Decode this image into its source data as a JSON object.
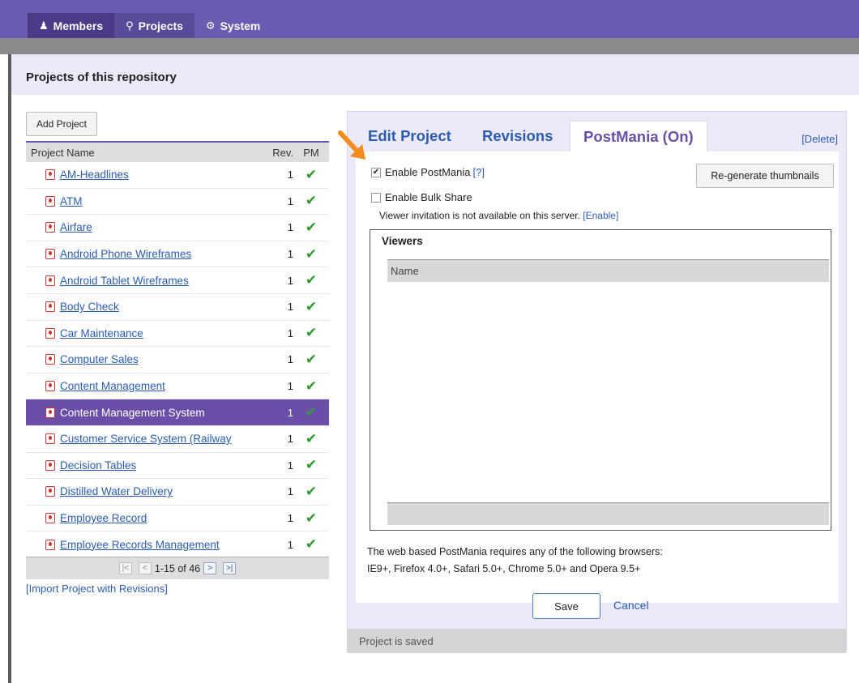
{
  "nav": {
    "tabs": [
      {
        "label": "Members",
        "icon": "person-icon"
      },
      {
        "label": "Projects",
        "icon": "pin-icon"
      },
      {
        "label": "System",
        "icon": "gear-icon"
      }
    ]
  },
  "page": {
    "title": "Projects of this repository"
  },
  "left": {
    "add_button": "Add Project",
    "columns": {
      "name": "Project Name",
      "rev": "Rev.",
      "pm": "PM"
    },
    "rows": [
      {
        "name": "AM-Headlines",
        "rev": "1",
        "pm": "✔"
      },
      {
        "name": "ATM",
        "rev": "1",
        "pm": "✔"
      },
      {
        "name": "Airfare",
        "rev": "1",
        "pm": "✔"
      },
      {
        "name": "Android Phone Wireframes",
        "rev": "1",
        "pm": "✔"
      },
      {
        "name": "Android Tablet Wireframes",
        "rev": "1",
        "pm": "✔"
      },
      {
        "name": "Body Check",
        "rev": "1",
        "pm": "✔"
      },
      {
        "name": "Car Maintenance",
        "rev": "1",
        "pm": "✔"
      },
      {
        "name": "Computer Sales",
        "rev": "1",
        "pm": "✔"
      },
      {
        "name": "Content Management",
        "rev": "1",
        "pm": "✔"
      },
      {
        "name": "Content Management System",
        "rev": "1",
        "pm": "✔",
        "selected": true
      },
      {
        "name": "Customer Service System (Railway",
        "rev": "1",
        "pm": "✔"
      },
      {
        "name": "Decision Tables",
        "rev": "1",
        "pm": "✔"
      },
      {
        "name": "Distilled Water Delivery",
        "rev": "1",
        "pm": "✔"
      },
      {
        "name": "Employee Record",
        "rev": "1",
        "pm": "✔"
      },
      {
        "name": "Employee Records Management",
        "rev": "1",
        "pm": "✔"
      }
    ],
    "pager": {
      "first": "|<",
      "prev": "<",
      "range": "1-15 of 46",
      "next": ">",
      "last": ">|"
    },
    "import_link": "[Import Project with Revisions]"
  },
  "right": {
    "tabs": {
      "edit": "Edit Project",
      "revisions": "Revisions",
      "postmania": "PostMania (On)"
    },
    "delete_link": "[Delete]",
    "enable_postmania": {
      "label": "Enable PostMania",
      "help": "[?]",
      "checked": true
    },
    "regen_button": "Re-generate thumbnails",
    "enable_bulk": {
      "label": "Enable Bulk Share",
      "checked": false
    },
    "viewer_note": "Viewer invitation is not available on this server.",
    "viewer_enable": "[Enable]",
    "viewers": {
      "title": "Viewers",
      "column": "Name"
    },
    "browser_note_1": "The web based PostMania requires any of the following browsers:",
    "browser_note_2": "IE9+, Firefox 4.0+, Safari 5.0+, Chrome 5.0+ and Opera 9.5+",
    "save_button": "Save",
    "cancel_link": "Cancel",
    "status": "Project is saved"
  },
  "colors": {
    "accent": "#6a5bb1",
    "selected_row": "#6a4fa8",
    "link": "#2a5db0",
    "check": "#2e9a2e",
    "arrow": "#f28c1e"
  }
}
